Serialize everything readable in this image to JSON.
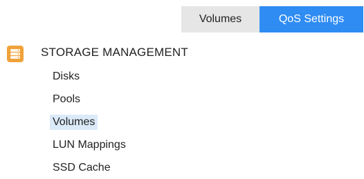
{
  "tabs": {
    "volumes_label": "Volumes",
    "qos_label": "QoS Settings",
    "active": "QoS Settings"
  },
  "section": {
    "icon": "storage-database-icon",
    "title": "STORAGE MANAGEMENT"
  },
  "nav": {
    "items": [
      {
        "label": "Disks"
      },
      {
        "label": "Pools"
      },
      {
        "label": "Volumes"
      },
      {
        "label": "LUN Mappings"
      },
      {
        "label": "SSD Cache"
      }
    ],
    "selected": "Volumes"
  },
  "colors": {
    "tab_active_bg": "#2f8cf3",
    "tab_inactive_bg": "#e6e6e6",
    "nav_selected_bg": "#dbeaf9",
    "icon_orange": "#f0a23a"
  }
}
